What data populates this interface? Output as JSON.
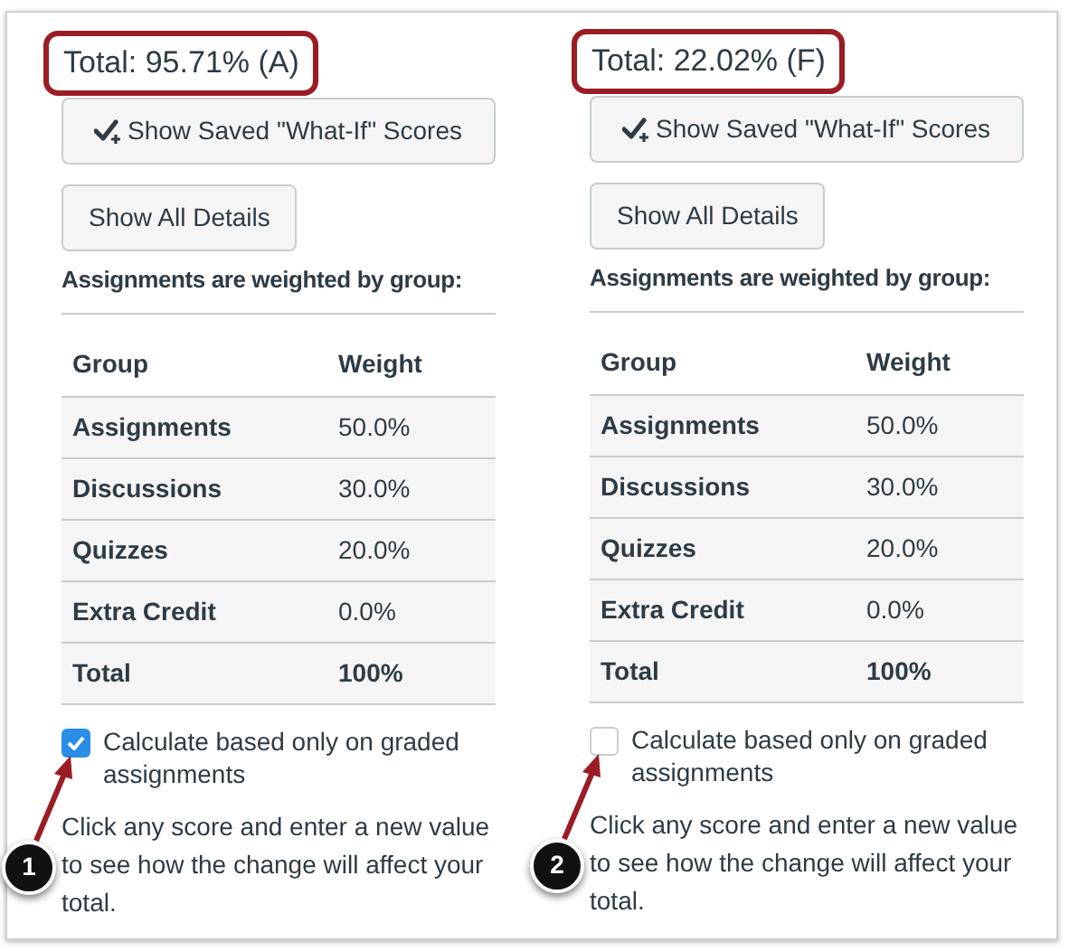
{
  "panels": [
    {
      "total": "Total: 95.71% (A)",
      "buttons": [
        {
          "kind": "what-if",
          "label": "Show Saved \"What-If\" Scores"
        },
        {
          "kind": "plain",
          "label": "Show All Details"
        }
      ],
      "heading": "Assignments are weighted by group:",
      "table": {
        "columns": [
          "Group",
          "Weight"
        ],
        "rows": [
          {
            "kind": "group",
            "group": "Assignments",
            "weight": "50.0%"
          },
          {
            "kind": "group",
            "group": "Discussions",
            "weight": "30.0%"
          },
          {
            "kind": "group",
            "group": "Quizzes",
            "weight": "20.0%"
          },
          {
            "kind": "group",
            "group": "Extra Credit",
            "weight": "0.0%"
          },
          {
            "kind": "total",
            "group": "Total",
            "weight": "100%"
          }
        ]
      },
      "checkbox": {
        "label": "Calculate based only on graded assignments",
        "checked": true
      },
      "hint": "Click any score and enter a new value to see how the change will affect your total.",
      "callout": "1"
    },
    {
      "total": "Total: 22.02% (F)",
      "buttons": [
        {
          "kind": "what-if",
          "label": "Show Saved \"What-If\" Scores"
        },
        {
          "kind": "plain",
          "label": "Show All Details"
        }
      ],
      "heading": "Assignments are weighted by group:",
      "table": {
        "columns": [
          "Group",
          "Weight"
        ],
        "rows": [
          {
            "kind": "group",
            "group": "Assignments",
            "weight": "50.0%"
          },
          {
            "kind": "group",
            "group": "Discussions",
            "weight": "30.0%"
          },
          {
            "kind": "group",
            "group": "Quizzes",
            "weight": "20.0%"
          },
          {
            "kind": "group",
            "group": "Extra Credit",
            "weight": "0.0%"
          },
          {
            "kind": "total",
            "group": "Total",
            "weight": "100%"
          }
        ]
      },
      "checkbox": {
        "label": "Calculate based only on graded assignments",
        "checked": false
      },
      "hint": "Click any score and enter a new value to see how the change will affect your total.",
      "callout": "2"
    }
  ]
}
